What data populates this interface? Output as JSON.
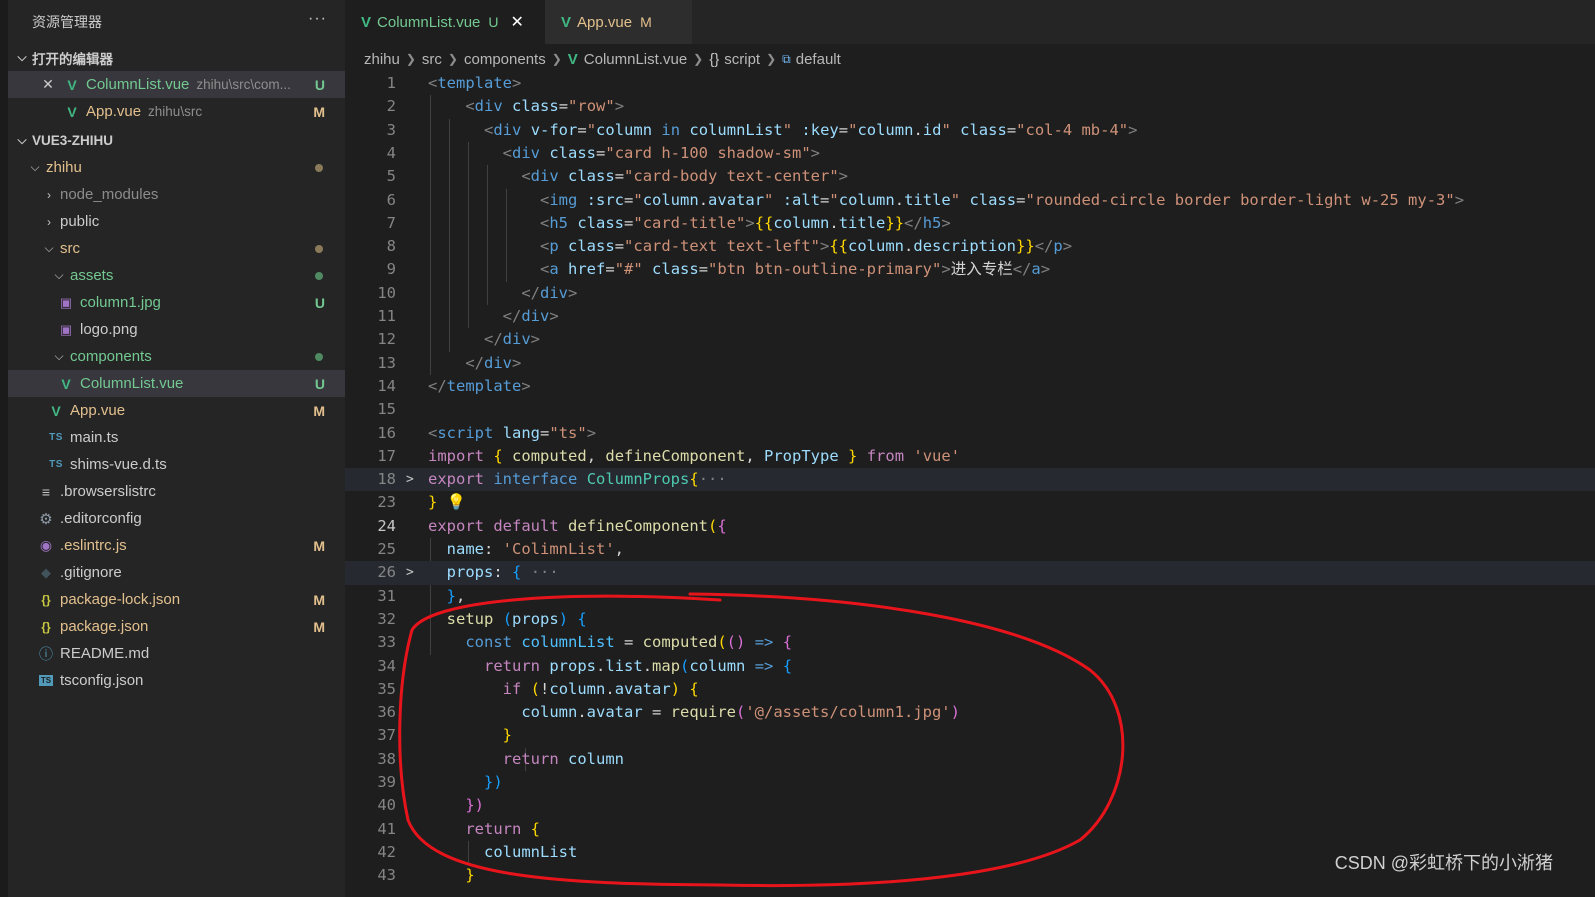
{
  "explorer": {
    "title": "资源管理器",
    "more": "···",
    "open_editors": {
      "label": "打开的编辑器",
      "items": [
        {
          "name": "ColumnList.vue",
          "desc": "zhihu\\src\\com...",
          "badge": "U"
        },
        {
          "name": "App.vue",
          "desc": "zhihu\\src",
          "badge": "M"
        }
      ]
    },
    "project": {
      "label": "VUE3-ZHIHU",
      "tree": [
        {
          "name": "zhihu"
        },
        {
          "name": "node_modules"
        },
        {
          "name": "public"
        },
        {
          "name": "src"
        },
        {
          "name": "assets"
        },
        {
          "name": "column1.jpg",
          "badge": "U"
        },
        {
          "name": "logo.png"
        },
        {
          "name": "components"
        },
        {
          "name": "ColumnList.vue",
          "badge": "U"
        },
        {
          "name": "App.vue",
          "badge": "M"
        },
        {
          "name": "main.ts",
          "icon": "TS"
        },
        {
          "name": "shims-vue.d.ts",
          "icon": "TS"
        },
        {
          "name": ".browserslistrc"
        },
        {
          "name": ".editorconfig"
        },
        {
          "name": ".eslintrc.js",
          "badge": "M"
        },
        {
          "name": ".gitignore"
        },
        {
          "name": "package-lock.json",
          "badge": "M"
        },
        {
          "name": "package.json",
          "badge": "M"
        },
        {
          "name": "README.md"
        },
        {
          "name": "tsconfig.json"
        }
      ]
    }
  },
  "tabs": [
    {
      "name": "ColumnList.vue",
      "status": "U",
      "close": "✕"
    },
    {
      "name": "App.vue",
      "status": "M"
    }
  ],
  "breadcrumb": [
    "zhihu",
    "src",
    "components",
    "ColumnList.vue",
    "script",
    "default"
  ],
  "code": [
    {
      "n": "1",
      "t": [
        [
          "t-br",
          "<"
        ],
        [
          "t-tag",
          "template"
        ],
        [
          "t-br",
          ">"
        ]
      ]
    },
    {
      "n": "2",
      "t": [
        [
          "t-txt",
          "    "
        ],
        [
          "t-br",
          "<"
        ],
        [
          "t-tag",
          "div"
        ],
        [
          "t-txt",
          " "
        ],
        [
          "t-attr",
          "class"
        ],
        [
          "t-txt",
          "="
        ],
        [
          "t-str",
          "\"row\""
        ],
        [
          "t-br",
          ">"
        ]
      ]
    },
    {
      "n": "3",
      "t": [
        [
          "t-txt",
          "      "
        ],
        [
          "t-br",
          "<"
        ],
        [
          "t-tag",
          "div"
        ],
        [
          "t-txt",
          " "
        ],
        [
          "t-attr",
          "v-for"
        ],
        [
          "t-txt",
          "="
        ],
        [
          "t-str",
          "\""
        ],
        [
          "t-var",
          "column"
        ],
        [
          "t-txt",
          " "
        ],
        [
          "t-kw",
          "in"
        ],
        [
          "t-txt",
          " "
        ],
        [
          "t-var",
          "columnList"
        ],
        [
          "t-str",
          "\""
        ],
        [
          "t-txt",
          " "
        ],
        [
          "t-attr",
          ":key"
        ],
        [
          "t-txt",
          "="
        ],
        [
          "t-str",
          "\""
        ],
        [
          "t-var",
          "column"
        ],
        [
          "t-txt",
          "."
        ],
        [
          "t-var",
          "id"
        ],
        [
          "t-str",
          "\""
        ],
        [
          "t-txt",
          " "
        ],
        [
          "t-attr",
          "class"
        ],
        [
          "t-txt",
          "="
        ],
        [
          "t-str",
          "\"col-4 mb-4\""
        ],
        [
          "t-br",
          ">"
        ]
      ]
    },
    {
      "n": "4",
      "t": [
        [
          "t-txt",
          "        "
        ],
        [
          "t-br",
          "<"
        ],
        [
          "t-tag",
          "div"
        ],
        [
          "t-txt",
          " "
        ],
        [
          "t-attr",
          "class"
        ],
        [
          "t-txt",
          "="
        ],
        [
          "t-str",
          "\"card h-100 shadow-sm\""
        ],
        [
          "t-br",
          ">"
        ]
      ]
    },
    {
      "n": "5",
      "t": [
        [
          "t-txt",
          "          "
        ],
        [
          "t-br",
          "<"
        ],
        [
          "t-tag",
          "div"
        ],
        [
          "t-txt",
          " "
        ],
        [
          "t-attr",
          "class"
        ],
        [
          "t-txt",
          "="
        ],
        [
          "t-str",
          "\"card-body text-center\""
        ],
        [
          "t-br",
          ">"
        ]
      ]
    },
    {
      "n": "6",
      "t": [
        [
          "t-txt",
          "            "
        ],
        [
          "t-br",
          "<"
        ],
        [
          "t-tag",
          "img"
        ],
        [
          "t-txt",
          " "
        ],
        [
          "t-attr",
          ":src"
        ],
        [
          "t-txt",
          "="
        ],
        [
          "t-str",
          "\""
        ],
        [
          "t-var",
          "column"
        ],
        [
          "t-txt",
          "."
        ],
        [
          "t-var",
          "avatar"
        ],
        [
          "t-str",
          "\""
        ],
        [
          "t-txt",
          " "
        ],
        [
          "t-attr",
          ":alt"
        ],
        [
          "t-txt",
          "="
        ],
        [
          "t-str",
          "\""
        ],
        [
          "t-var",
          "column"
        ],
        [
          "t-txt",
          "."
        ],
        [
          "t-var",
          "title"
        ],
        [
          "t-str",
          "\""
        ],
        [
          "t-txt",
          " "
        ],
        [
          "t-attr",
          "class"
        ],
        [
          "t-txt",
          "="
        ],
        [
          "t-str",
          "\"rounded-circle border border-light w-25 my-3\""
        ],
        [
          "t-br",
          ">"
        ]
      ]
    },
    {
      "n": "7",
      "t": [
        [
          "t-txt",
          "            "
        ],
        [
          "t-br",
          "<"
        ],
        [
          "t-tag",
          "h5"
        ],
        [
          "t-txt",
          " "
        ],
        [
          "t-attr",
          "class"
        ],
        [
          "t-txt",
          "="
        ],
        [
          "t-str",
          "\"card-title\""
        ],
        [
          "t-br",
          ">"
        ],
        [
          "t-p1",
          "{{"
        ],
        [
          "t-var",
          "column"
        ],
        [
          "t-txt",
          "."
        ],
        [
          "t-var",
          "title"
        ],
        [
          "t-p1",
          "}}"
        ],
        [
          "t-br",
          "</"
        ],
        [
          "t-tag",
          "h5"
        ],
        [
          "t-br",
          ">"
        ]
      ]
    },
    {
      "n": "8",
      "t": [
        [
          "t-txt",
          "            "
        ],
        [
          "t-br",
          "<"
        ],
        [
          "t-tag",
          "p"
        ],
        [
          "t-txt",
          " "
        ],
        [
          "t-attr",
          "class"
        ],
        [
          "t-txt",
          "="
        ],
        [
          "t-str",
          "\"card-text text-left\""
        ],
        [
          "t-br",
          ">"
        ],
        [
          "t-p1",
          "{{"
        ],
        [
          "t-var",
          "column"
        ],
        [
          "t-txt",
          "."
        ],
        [
          "t-var",
          "description"
        ],
        [
          "t-p1",
          "}}"
        ],
        [
          "t-br",
          "</"
        ],
        [
          "t-tag",
          "p"
        ],
        [
          "t-br",
          ">"
        ]
      ]
    },
    {
      "n": "9",
      "t": [
        [
          "t-txt",
          "            "
        ],
        [
          "t-br",
          "<"
        ],
        [
          "t-tag",
          "a"
        ],
        [
          "t-txt",
          " "
        ],
        [
          "t-attr",
          "href"
        ],
        [
          "t-txt",
          "="
        ],
        [
          "t-str",
          "\"#\""
        ],
        [
          "t-txt",
          " "
        ],
        [
          "t-attr",
          "class"
        ],
        [
          "t-txt",
          "="
        ],
        [
          "t-str",
          "\"btn btn-outline-primary\""
        ],
        [
          "t-br",
          ">"
        ],
        [
          "t-txt",
          "进入专栏"
        ],
        [
          "t-br",
          "</"
        ],
        [
          "t-tag",
          "a"
        ],
        [
          "t-br",
          ">"
        ]
      ]
    },
    {
      "n": "10",
      "t": [
        [
          "t-txt",
          "          "
        ],
        [
          "t-br",
          "</"
        ],
        [
          "t-tag",
          "div"
        ],
        [
          "t-br",
          ">"
        ]
      ]
    },
    {
      "n": "11",
      "t": [
        [
          "t-txt",
          "        "
        ],
        [
          "t-br",
          "</"
        ],
        [
          "t-tag",
          "div"
        ],
        [
          "t-br",
          ">"
        ]
      ]
    },
    {
      "n": "12",
      "t": [
        [
          "t-txt",
          "      "
        ],
        [
          "t-br",
          "</"
        ],
        [
          "t-tag",
          "div"
        ],
        [
          "t-br",
          ">"
        ]
      ]
    },
    {
      "n": "13",
      "t": [
        [
          "t-txt",
          "    "
        ],
        [
          "t-br",
          "</"
        ],
        [
          "t-tag",
          "div"
        ],
        [
          "t-br",
          ">"
        ]
      ]
    },
    {
      "n": "14",
      "t": [
        [
          "t-br",
          "</"
        ],
        [
          "t-tag",
          "template"
        ],
        [
          "t-br",
          ">"
        ]
      ]
    },
    {
      "n": "15",
      "t": []
    },
    {
      "n": "16",
      "t": [
        [
          "t-br",
          "<"
        ],
        [
          "t-tag",
          "script"
        ],
        [
          "t-txt",
          " "
        ],
        [
          "t-attr",
          "lang"
        ],
        [
          "t-txt",
          "="
        ],
        [
          "t-str",
          "\"ts\""
        ],
        [
          "t-br",
          ">"
        ]
      ]
    },
    {
      "n": "17",
      "t": [
        [
          "t-kw2",
          "import"
        ],
        [
          "t-txt",
          " "
        ],
        [
          "t-p1",
          "{"
        ],
        [
          "t-txt",
          " "
        ],
        [
          "t-fn",
          "computed"
        ],
        [
          "t-txt",
          ", "
        ],
        [
          "t-fn",
          "defineComponent"
        ],
        [
          "t-txt",
          ", "
        ],
        [
          "t-var",
          "PropType"
        ],
        [
          "t-txt",
          " "
        ],
        [
          "t-p1",
          "}"
        ],
        [
          "t-txt",
          " "
        ],
        [
          "t-kw2",
          "from"
        ],
        [
          "t-txt",
          " "
        ],
        [
          "t-str",
          "'vue'"
        ]
      ]
    },
    {
      "n": "18",
      "fold": ">",
      "hl": true,
      "t": [
        [
          "t-kw2",
          "export"
        ],
        [
          "t-txt",
          " "
        ],
        [
          "t-kw",
          "interface"
        ],
        [
          "t-txt",
          " "
        ],
        [
          "t-type",
          "ColumnProps"
        ],
        [
          "t-p1",
          "{"
        ],
        [
          "t-fold",
          "···"
        ]
      ]
    },
    {
      "n": "23",
      "t": [
        [
          "t-p1",
          "}"
        ],
        [
          "t-txt",
          " 💡"
        ]
      ]
    },
    {
      "n": "24",
      "cur": true,
      "t": [
        [
          "t-kw2",
          "export"
        ],
        [
          "t-txt",
          " "
        ],
        [
          "t-kw2",
          "default"
        ],
        [
          "t-txt",
          " "
        ],
        [
          "t-fn",
          "defineComponent"
        ],
        [
          "t-p1",
          "("
        ],
        [
          "t-p2",
          "{"
        ]
      ]
    },
    {
      "n": "25",
      "t": [
        [
          "t-txt",
          "  "
        ],
        [
          "t-var",
          "name"
        ],
        [
          "t-txt",
          ": "
        ],
        [
          "t-str",
          "'ColimnList'"
        ],
        [
          "t-txt",
          ","
        ]
      ]
    },
    {
      "n": "26",
      "fold": ">",
      "hl": true,
      "t": [
        [
          "t-txt",
          "  "
        ],
        [
          "t-var",
          "props"
        ],
        [
          "t-txt",
          ": "
        ],
        [
          "t-p3",
          "{"
        ],
        [
          "t-txt",
          " "
        ],
        [
          "t-fold",
          "···"
        ]
      ]
    },
    {
      "n": "31",
      "t": [
        [
          "t-txt",
          "  "
        ],
        [
          "t-p3",
          "}"
        ],
        [
          "t-txt",
          ","
        ]
      ]
    },
    {
      "n": "32",
      "t": [
        [
          "t-txt",
          "  "
        ],
        [
          "t-fn",
          "setup"
        ],
        [
          "t-txt",
          " "
        ],
        [
          "t-p3",
          "("
        ],
        [
          "t-var",
          "props"
        ],
        [
          "t-p3",
          ")"
        ],
        [
          "t-txt",
          " "
        ],
        [
          "t-p3",
          "{"
        ]
      ]
    },
    {
      "n": "33",
      "t": [
        [
          "t-txt",
          "    "
        ],
        [
          "t-kw",
          "const"
        ],
        [
          "t-txt",
          " "
        ],
        [
          "t-cn",
          "columnList"
        ],
        [
          "t-txt",
          " = "
        ],
        [
          "t-fn",
          "computed"
        ],
        [
          "t-p1",
          "("
        ],
        [
          "t-p2",
          "()"
        ],
        [
          "t-txt",
          " "
        ],
        [
          "t-kw",
          "=>"
        ],
        [
          "t-txt",
          " "
        ],
        [
          "t-p2",
          "{"
        ]
      ]
    },
    {
      "n": "34",
      "t": [
        [
          "t-txt",
          "      "
        ],
        [
          "t-kw2",
          "return"
        ],
        [
          "t-txt",
          " "
        ],
        [
          "t-var",
          "props"
        ],
        [
          "t-txt",
          "."
        ],
        [
          "t-var",
          "list"
        ],
        [
          "t-txt",
          "."
        ],
        [
          "t-fn",
          "map"
        ],
        [
          "t-p3",
          "("
        ],
        [
          "t-var",
          "column"
        ],
        [
          "t-txt",
          " "
        ],
        [
          "t-kw",
          "=>"
        ],
        [
          "t-txt",
          " "
        ],
        [
          "t-p3",
          "{"
        ]
      ]
    },
    {
      "n": "35",
      "t": [
        [
          "t-txt",
          "        "
        ],
        [
          "t-kw2",
          "if"
        ],
        [
          "t-txt",
          " "
        ],
        [
          "t-p1",
          "("
        ],
        [
          "t-txt",
          "!"
        ],
        [
          "t-var",
          "column"
        ],
        [
          "t-txt",
          "."
        ],
        [
          "t-var",
          "avatar"
        ],
        [
          "t-p1",
          ")"
        ],
        [
          "t-txt",
          " "
        ],
        [
          "t-p1",
          "{"
        ]
      ]
    },
    {
      "n": "36",
      "t": [
        [
          "t-txt",
          "          "
        ],
        [
          "t-var",
          "column"
        ],
        [
          "t-txt",
          "."
        ],
        [
          "t-var",
          "avatar"
        ],
        [
          "t-txt",
          " = "
        ],
        [
          "t-fn",
          "require"
        ],
        [
          "t-p2",
          "("
        ],
        [
          "t-str",
          "'@/assets/column1.jpg'"
        ],
        [
          "t-p2",
          ")"
        ]
      ]
    },
    {
      "n": "37",
      "t": [
        [
          "t-txt",
          "        "
        ],
        [
          "t-p1",
          "}"
        ]
      ]
    },
    {
      "n": "38",
      "t": [
        [
          "t-txt",
          "        "
        ],
        [
          "t-kw2",
          "return"
        ],
        [
          "t-txt",
          " "
        ],
        [
          "t-var",
          "column"
        ]
      ]
    },
    {
      "n": "39",
      "t": [
        [
          "t-txt",
          "      "
        ],
        [
          "t-p3",
          "})"
        ]
      ]
    },
    {
      "n": "40",
      "t": [
        [
          "t-txt",
          "    "
        ],
        [
          "t-p2",
          "})"
        ]
      ]
    },
    {
      "n": "41",
      "t": [
        [
          "t-txt",
          "    "
        ],
        [
          "t-kw2",
          "return"
        ],
        [
          "t-txt",
          " "
        ],
        [
          "t-p1",
          "{"
        ]
      ]
    },
    {
      "n": "42",
      "t": [
        [
          "t-txt",
          "      "
        ],
        [
          "t-var",
          "columnList"
        ]
      ]
    },
    {
      "n": "43",
      "t": [
        [
          "t-txt",
          "    "
        ],
        [
          "t-p1",
          "}"
        ]
      ]
    }
  ],
  "watermark": "CSDN @彩虹桥下的小淅猪",
  "colors": {
    "annotation": "#e8141b",
    "accent_vue": "#41b883",
    "modified": "#e2c08d",
    "untracked": "#73c991"
  }
}
